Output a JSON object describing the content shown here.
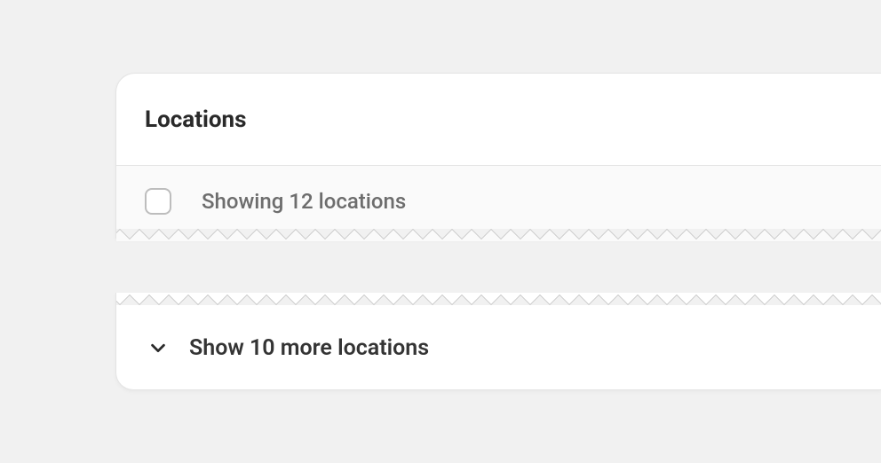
{
  "locations": {
    "header_title": "Locations",
    "showing_text": "Showing 12 locations",
    "show_more_label": "Show 10 more locations"
  }
}
